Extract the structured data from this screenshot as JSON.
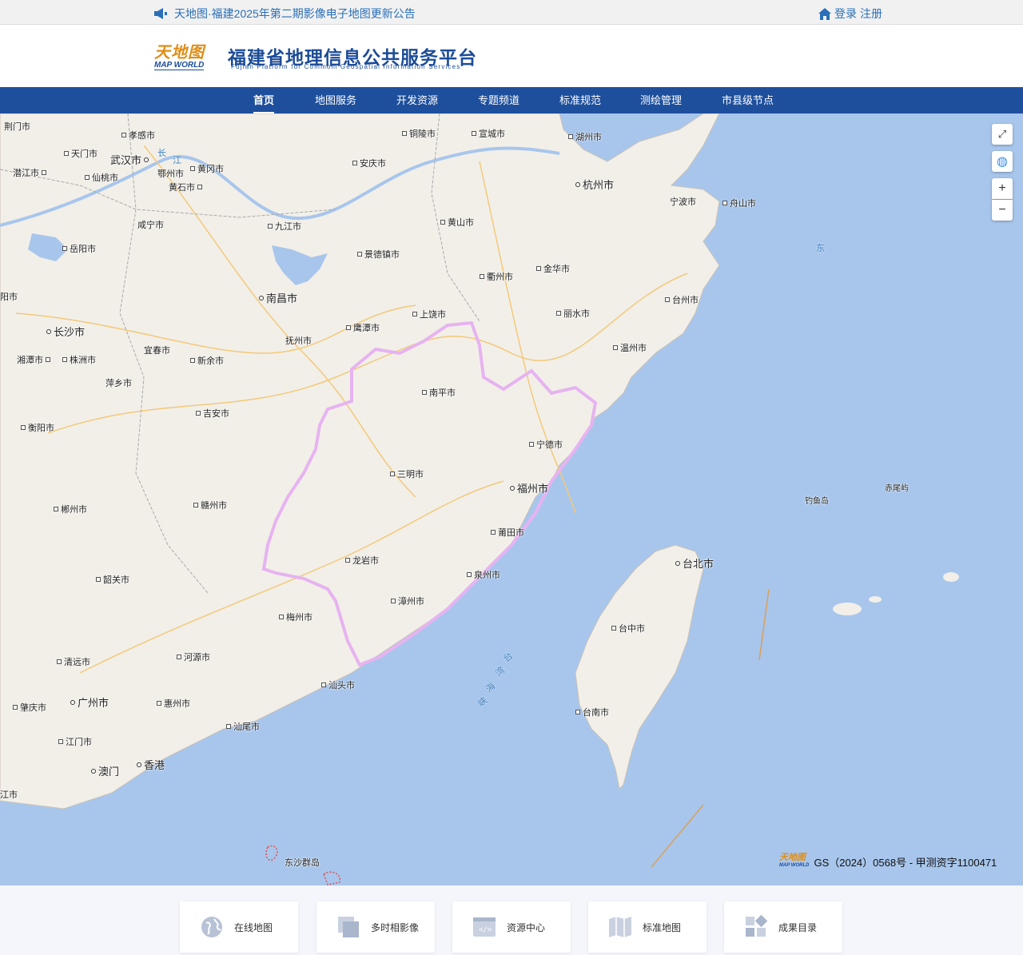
{
  "topbar": {
    "notice": "天地图·福建2025年第二期影像电子地图更新公告",
    "login": "登录",
    "register": "注册"
  },
  "header": {
    "logo_cn": "天地图",
    "logo_en": "MAP WORLD",
    "title": "福建省地理信息公共服务平台",
    "subtitle": "Fujian Platform for Commom Geospatial Information Services"
  },
  "nav": {
    "items": [
      {
        "label": "首页"
      },
      {
        "label": "地图服务"
      },
      {
        "label": "开发资源"
      },
      {
        "label": "专题频道"
      },
      {
        "label": "标准规范"
      },
      {
        "label": "测绘管理"
      },
      {
        "label": "市县级节点"
      }
    ]
  },
  "map": {
    "cities": [
      {
        "name": "荆门市"
      },
      {
        "name": "孝感市"
      },
      {
        "name": "天门市"
      },
      {
        "name": "武汉市"
      },
      {
        "name": "潜江市"
      },
      {
        "name": "仙桃市"
      },
      {
        "name": "鄂州市"
      },
      {
        "name": "黄冈市"
      },
      {
        "name": "黄石市"
      },
      {
        "name": "咸宁市"
      },
      {
        "name": "岳阳市"
      },
      {
        "name": "铜陵市"
      },
      {
        "name": "宣城市"
      },
      {
        "name": "湖州市"
      },
      {
        "name": "安庆市"
      },
      {
        "name": "杭州市"
      },
      {
        "name": "宁波市"
      },
      {
        "name": "舟山市"
      },
      {
        "name": "九江市"
      },
      {
        "name": "黄山市"
      },
      {
        "name": "景德镇市"
      },
      {
        "name": "金华市"
      },
      {
        "name": "衢州市"
      },
      {
        "name": "南昌市"
      },
      {
        "name": "上饶市"
      },
      {
        "name": "丽水市"
      },
      {
        "name": "台州市"
      },
      {
        "name": "阳市"
      },
      {
        "name": "长沙市"
      },
      {
        "name": "鹰潭市"
      },
      {
        "name": "抚州市"
      },
      {
        "name": "温州市"
      },
      {
        "name": "宜春市"
      },
      {
        "name": "湘潭市"
      },
      {
        "name": "株洲市"
      },
      {
        "name": "新余市"
      },
      {
        "name": "萍乡市"
      },
      {
        "name": "南平市"
      },
      {
        "name": "吉安市"
      },
      {
        "name": "衡阳市"
      },
      {
        "name": "宁德市"
      },
      {
        "name": "三明市"
      },
      {
        "name": "福州市"
      },
      {
        "name": "钓鱼岛"
      },
      {
        "name": "赤尾屿"
      },
      {
        "name": "郴州市"
      },
      {
        "name": "赣州市"
      },
      {
        "name": "莆田市"
      },
      {
        "name": "龙岩市"
      },
      {
        "name": "台北市"
      },
      {
        "name": "韶关市"
      },
      {
        "name": "泉州市"
      },
      {
        "name": "漳州市"
      },
      {
        "name": "台中市"
      },
      {
        "name": "梅州市"
      },
      {
        "name": "清远市"
      },
      {
        "name": "河源市"
      },
      {
        "name": "汕头市"
      },
      {
        "name": "广州市"
      },
      {
        "name": "肇庆市"
      },
      {
        "name": "惠州市"
      },
      {
        "name": "台南市"
      },
      {
        "name": "汕尾市"
      },
      {
        "name": "江门市"
      },
      {
        "name": "澳门"
      },
      {
        "name": "香港"
      },
      {
        "name": "江市"
      },
      {
        "name": "东沙群岛"
      }
    ],
    "sea_labels": [
      "东",
      "长",
      "江",
      "台",
      "湾",
      "海",
      "峡"
    ],
    "credit": "GS（2024）0568号 - 甲测资字1100471",
    "controls": {
      "fullscreen": "⤢",
      "globe": "◍",
      "zoom_in": "+",
      "zoom_out": "−"
    }
  },
  "footer": {
    "cards": [
      {
        "label": "在线地图",
        "icon": "globe-icon"
      },
      {
        "label": "多时相影像",
        "icon": "layers-icon"
      },
      {
        "label": "资源中心",
        "icon": "code-window-icon"
      },
      {
        "label": "标准地图",
        "icon": "folded-map-icon"
      },
      {
        "label": "成果目录",
        "icon": "catalog-icon"
      }
    ]
  },
  "colors": {
    "brand_blue": "#1e4f9c",
    "link_blue": "#2a6fb7",
    "logo_orange": "#e08d15",
    "sea": "#a8c6ec",
    "land": "#f2efe9",
    "boundary": "#e6b3f0"
  }
}
